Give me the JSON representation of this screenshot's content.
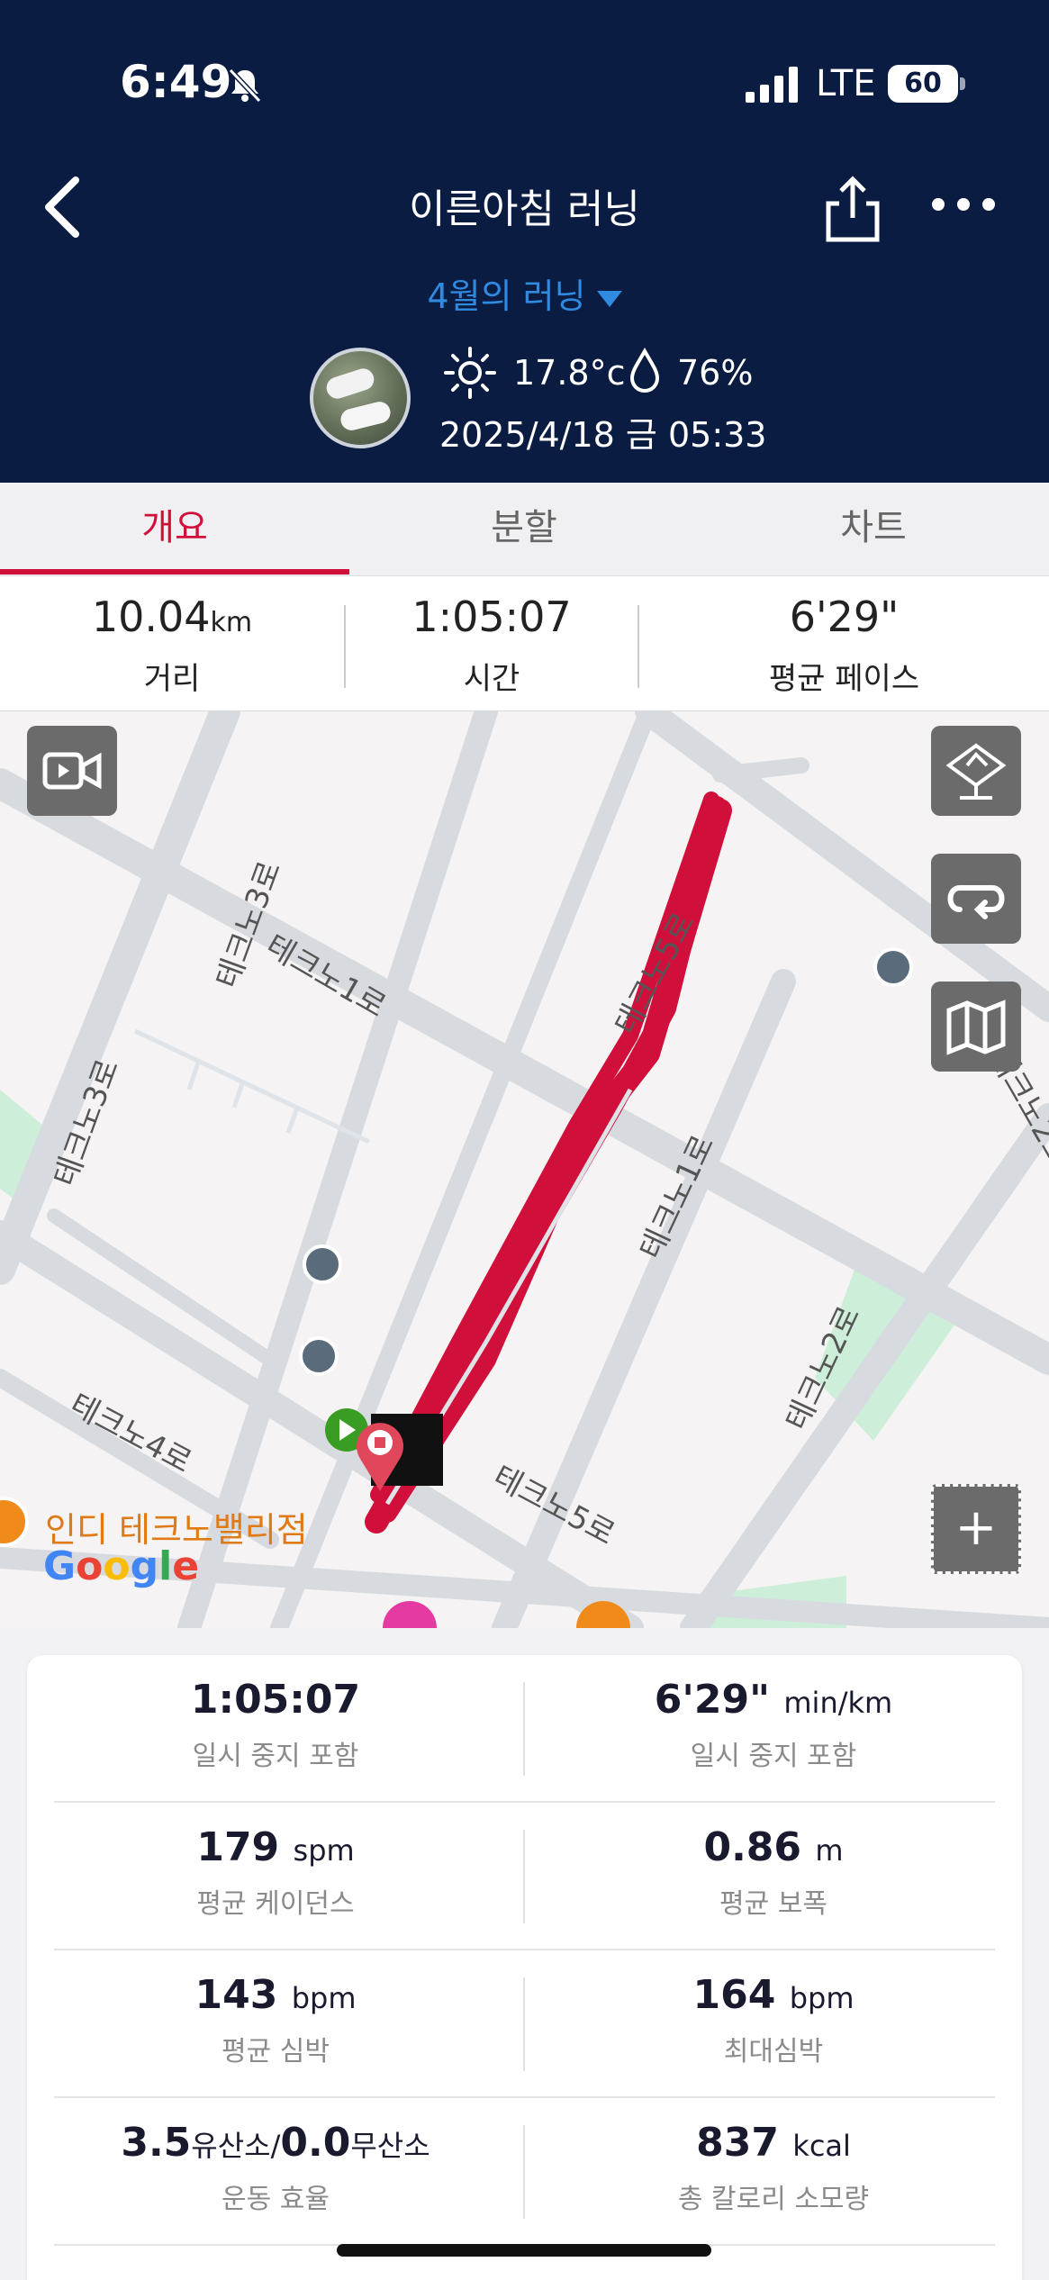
{
  "status_bar": {
    "time": "6:49",
    "network": "LTE",
    "battery": "60"
  },
  "header": {
    "title": "이른아침 러닝",
    "subtitle": "4월의 러닝",
    "temperature": "17.8°c",
    "humidity": "76%",
    "datetime": "2025/4/18 금 05:33"
  },
  "tabs": [
    {
      "label": "개요",
      "active": true
    },
    {
      "label": "분할",
      "active": false
    },
    {
      "label": "차트",
      "active": false
    }
  ],
  "summary": {
    "distance": {
      "value": "10.04",
      "unit": "km",
      "label": "거리"
    },
    "time": {
      "value": "1:05:07",
      "label": "시간"
    },
    "pace": {
      "value": "6'29\"",
      "label": "평균 페이스"
    }
  },
  "map": {
    "road_labels": [
      "테크노3로",
      "테크노1로",
      "테크노5로",
      "테크노3로",
      "테크노1로",
      "테크노2로",
      "테크노4로",
      "테크노5로",
      "테크노2로"
    ],
    "poi": "인디 테크노밸리점",
    "google": "Google",
    "route_color": "#d0103a"
  },
  "stats": [
    {
      "left": {
        "value": "1:05:07",
        "unit": "",
        "label": "일시 중지 포함"
      },
      "right": {
        "value": "6'29\"",
        "unit": "min/km",
        "label": "일시 중지 포함"
      }
    },
    {
      "left": {
        "value": "179",
        "unit": "spm",
        "label": "평균 케이던스"
      },
      "right": {
        "value": "0.86",
        "unit": "m",
        "label": "평균 보폭"
      }
    },
    {
      "left": {
        "value": "143",
        "unit": "bpm",
        "label": "평균 심박"
      },
      "right": {
        "value": "164",
        "unit": "bpm",
        "label": "최대심박"
      }
    },
    {
      "left": {
        "value": "3.5",
        "unit": "유산소/",
        "value2": "0.0",
        "unit2": "무산소",
        "label": "운동 효율"
      },
      "right": {
        "value": "837",
        "unit": "kcal",
        "label": "총 칼로리 소모량"
      }
    }
  ],
  "colors": {
    "header_bg": "#0b1c43",
    "accent": "#d0103a",
    "link": "#2f8be0"
  }
}
